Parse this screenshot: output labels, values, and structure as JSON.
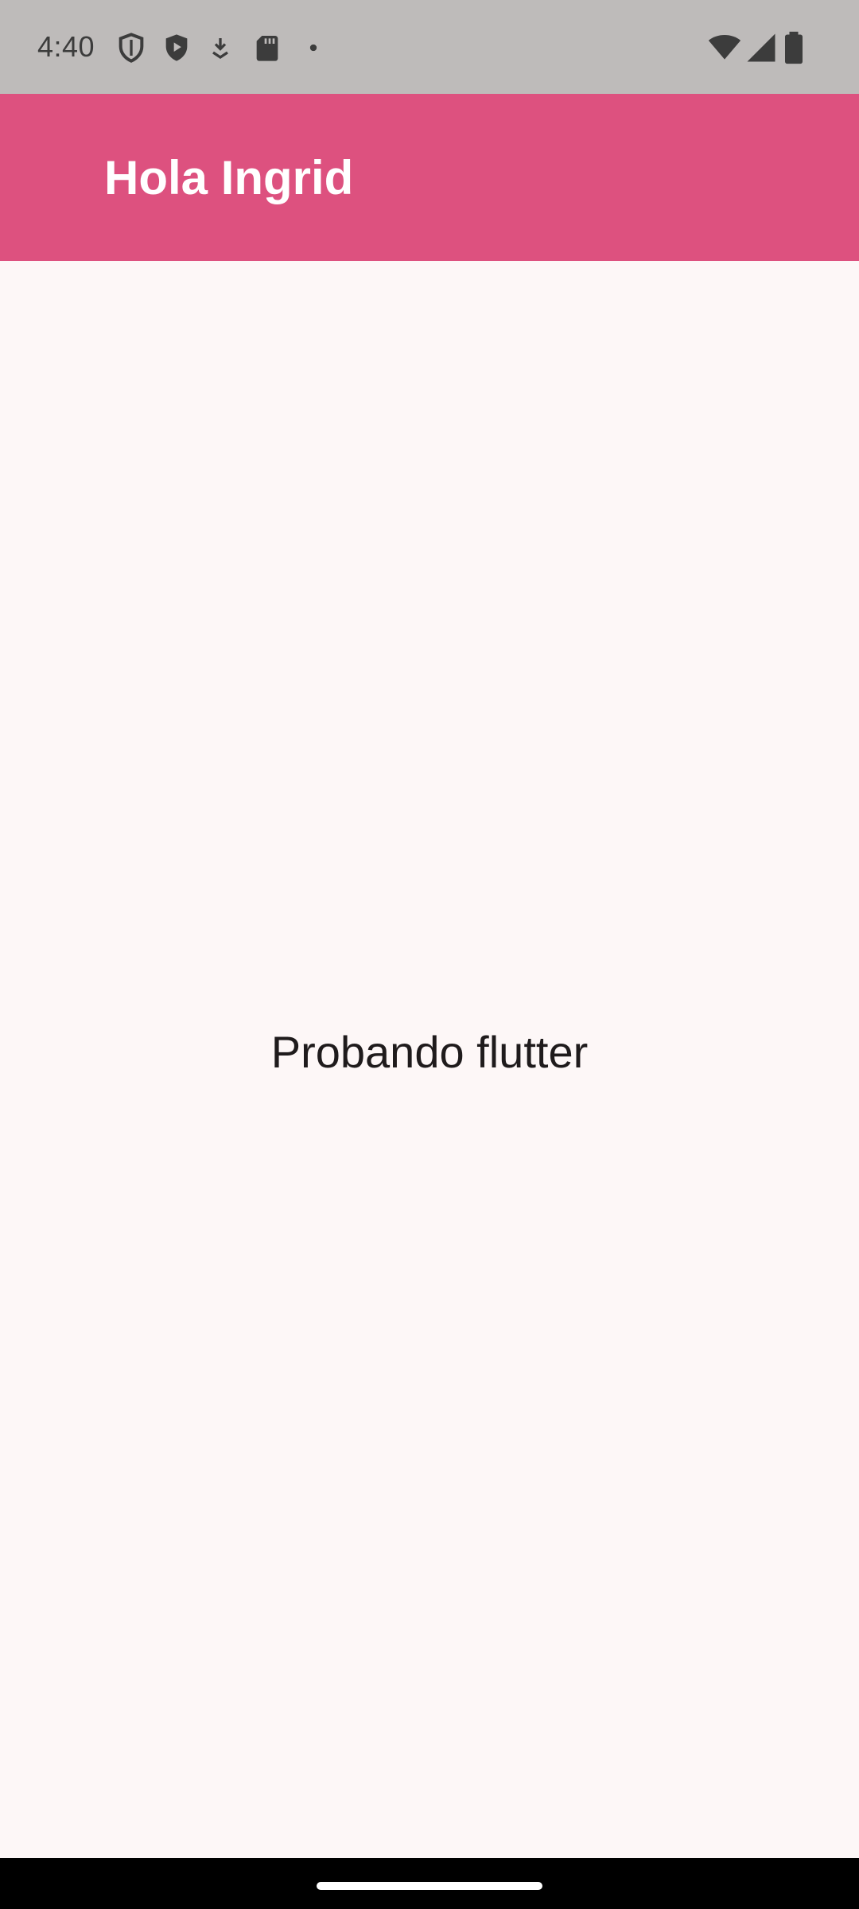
{
  "status_bar": {
    "time": "4:40",
    "left_icons": [
      "shield-outline-icon",
      "play-shield-icon",
      "download-arrow-icon",
      "sd-card-icon",
      "dot-icon"
    ],
    "right_icons": [
      "wifi-icon",
      "cell-signal-icon",
      "battery-icon"
    ]
  },
  "app_bar": {
    "title": "Hola Ingrid",
    "color": "#dd517f"
  },
  "body": {
    "text": "Probando flutter",
    "background": "#fdf7f7"
  }
}
